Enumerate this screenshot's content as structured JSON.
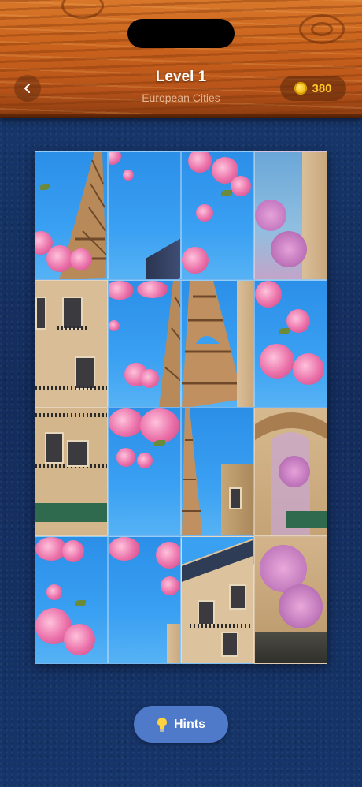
{
  "header": {
    "title": "Level 1",
    "subtitle": "European Cities",
    "coins": "380",
    "back_icon": "chevron-left-icon",
    "coin_icon": "coin-icon"
  },
  "puzzle": {
    "rows": 4,
    "columns": 4,
    "theme": "Eiffel Tower with cherry blossoms",
    "tiles": [
      "tower-left-blossom",
      "sky-blossom-corner",
      "blossom-top",
      "blossom-building-right",
      "building-facade",
      "sky-blossom-tower",
      "tower-center",
      "blossom-right",
      "building-balconies",
      "blossom-sky",
      "tower-spire-building",
      "tower-base-trees",
      "blossom-bottom-left",
      "blossom-sky-corner",
      "building-roof",
      "tree-building"
    ]
  },
  "hints_button": {
    "label": "Hints",
    "icon": "lightbulb-icon"
  },
  "colors": {
    "wood": "#c9621c",
    "background": "#15305f",
    "hint_button": "#4f79c9",
    "coin_text": "#ffc928"
  }
}
